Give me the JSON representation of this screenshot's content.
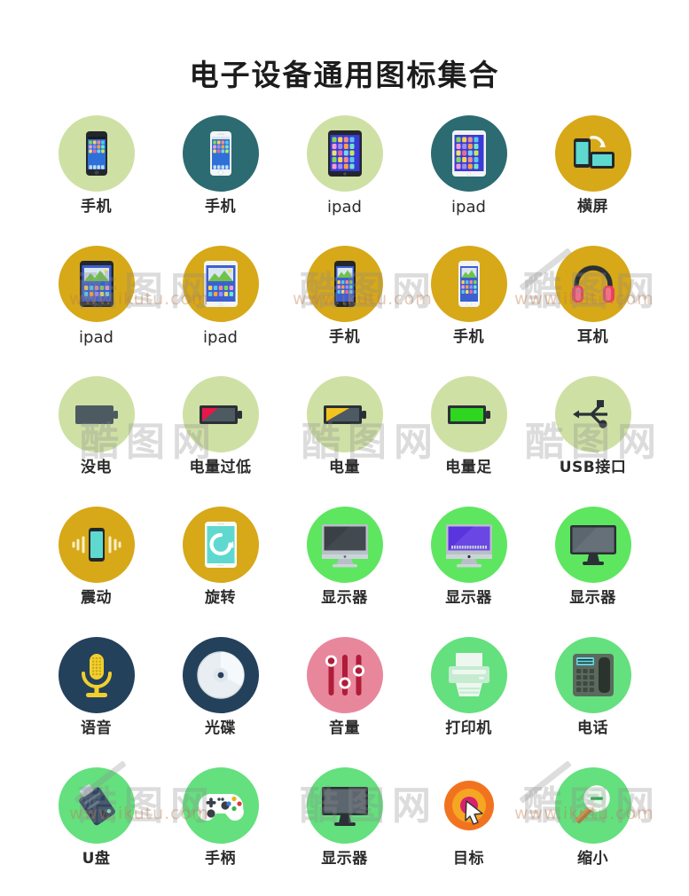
{
  "header": {
    "title": "电子设备通用图标集合"
  },
  "watermark": {
    "brand": "酷图网",
    "url": "www.ikutu.com"
  },
  "palette": {
    "light_green": "#cfe0a5",
    "teal": "#2d6b72",
    "gold": "#d7a818",
    "bright_green": "#5ee661",
    "navy": "#24415c",
    "pink": "#e8879c",
    "mint_green": "#64e07e",
    "orange": "#f2731f",
    "label_color": "#2b2b2b",
    "title_color": "#1c1c1c",
    "background": "#ffffff"
  },
  "grid": {
    "columns": 5,
    "rows": 6,
    "icons": [
      {
        "label": "手机",
        "icon": "smartphone-dark-icon",
        "bg": "#cfe0a5",
        "latin": false
      },
      {
        "label": "手机",
        "icon": "smartphone-white-icon",
        "bg": "#2d6b72",
        "latin": false
      },
      {
        "label": "ipad",
        "icon": "tablet-dark-icon",
        "bg": "#cfe0a5",
        "latin": true
      },
      {
        "label": "ipad",
        "icon": "tablet-white-icon",
        "bg": "#2d6b72",
        "latin": true
      },
      {
        "label": "横屏",
        "icon": "screen-rotate-icon",
        "bg": "#d7a818",
        "latin": false
      },
      {
        "label": "ipad",
        "icon": "tablet-dark-media-icon",
        "bg": "#d7a818",
        "latin": true
      },
      {
        "label": "ipad",
        "icon": "tablet-white-media-icon",
        "bg": "#d7a818",
        "latin": true
      },
      {
        "label": "手机",
        "icon": "phone-dark-media-icon",
        "bg": "#d7a818",
        "latin": false
      },
      {
        "label": "手机",
        "icon": "phone-white-media-icon",
        "bg": "#d7a818",
        "latin": false
      },
      {
        "label": "耳机",
        "icon": "headphones-icon",
        "bg": "#d7a818",
        "latin": false
      },
      {
        "label": "没电",
        "icon": "battery-empty-icon",
        "bg": "#cfe0a5",
        "latin": false
      },
      {
        "label": "电量过低",
        "icon": "battery-low-icon",
        "bg": "#cfe0a5",
        "latin": false
      },
      {
        "label": "电量",
        "icon": "battery-half-icon",
        "bg": "#cfe0a5",
        "latin": false
      },
      {
        "label": "电量足",
        "icon": "battery-full-icon",
        "bg": "#cfe0a5",
        "latin": false
      },
      {
        "label": "USB接口",
        "icon": "usb-icon",
        "bg": "#cfe0a5",
        "latin": false
      },
      {
        "label": "震动",
        "icon": "vibrate-icon",
        "bg": "#d7a818",
        "latin": false
      },
      {
        "label": "旋转",
        "icon": "rotate-icon",
        "bg": "#d7a818",
        "latin": false
      },
      {
        "label": "显示器",
        "icon": "imac-dark-icon",
        "bg": "#5ee661",
        "latin": false
      },
      {
        "label": "显示器",
        "icon": "imac-purple-icon",
        "bg": "#5ee661",
        "latin": false
      },
      {
        "label": "显示器",
        "icon": "monitor-gray-icon",
        "bg": "#5ee661",
        "latin": false
      },
      {
        "label": "语音",
        "icon": "microphone-icon",
        "bg": "#24415c",
        "latin": false
      },
      {
        "label": "光碟",
        "icon": "disc-icon",
        "bg": "#24415c",
        "latin": false
      },
      {
        "label": "音量",
        "icon": "volume-sliders-icon",
        "bg": "#e8879c",
        "latin": false
      },
      {
        "label": "打印机",
        "icon": "printer-icon",
        "bg": "#64e07e",
        "latin": false
      },
      {
        "label": "电话",
        "icon": "telephone-icon",
        "bg": "#64e07e",
        "latin": false
      },
      {
        "label": "U盘",
        "icon": "usb-drive-icon",
        "bg": "#64e07e",
        "latin": false
      },
      {
        "label": "手柄",
        "icon": "gamepad-icon",
        "bg": "#64e07e",
        "latin": false
      },
      {
        "label": "显示器",
        "icon": "monitor-flat-icon",
        "bg": "#64e07e",
        "latin": false
      },
      {
        "label": "目标",
        "icon": "target-cursor-icon",
        "bg": "#ffffff",
        "latin": false
      },
      {
        "label": "缩小",
        "icon": "zoom-out-icon",
        "bg": "#64e07e",
        "latin": false
      }
    ]
  }
}
